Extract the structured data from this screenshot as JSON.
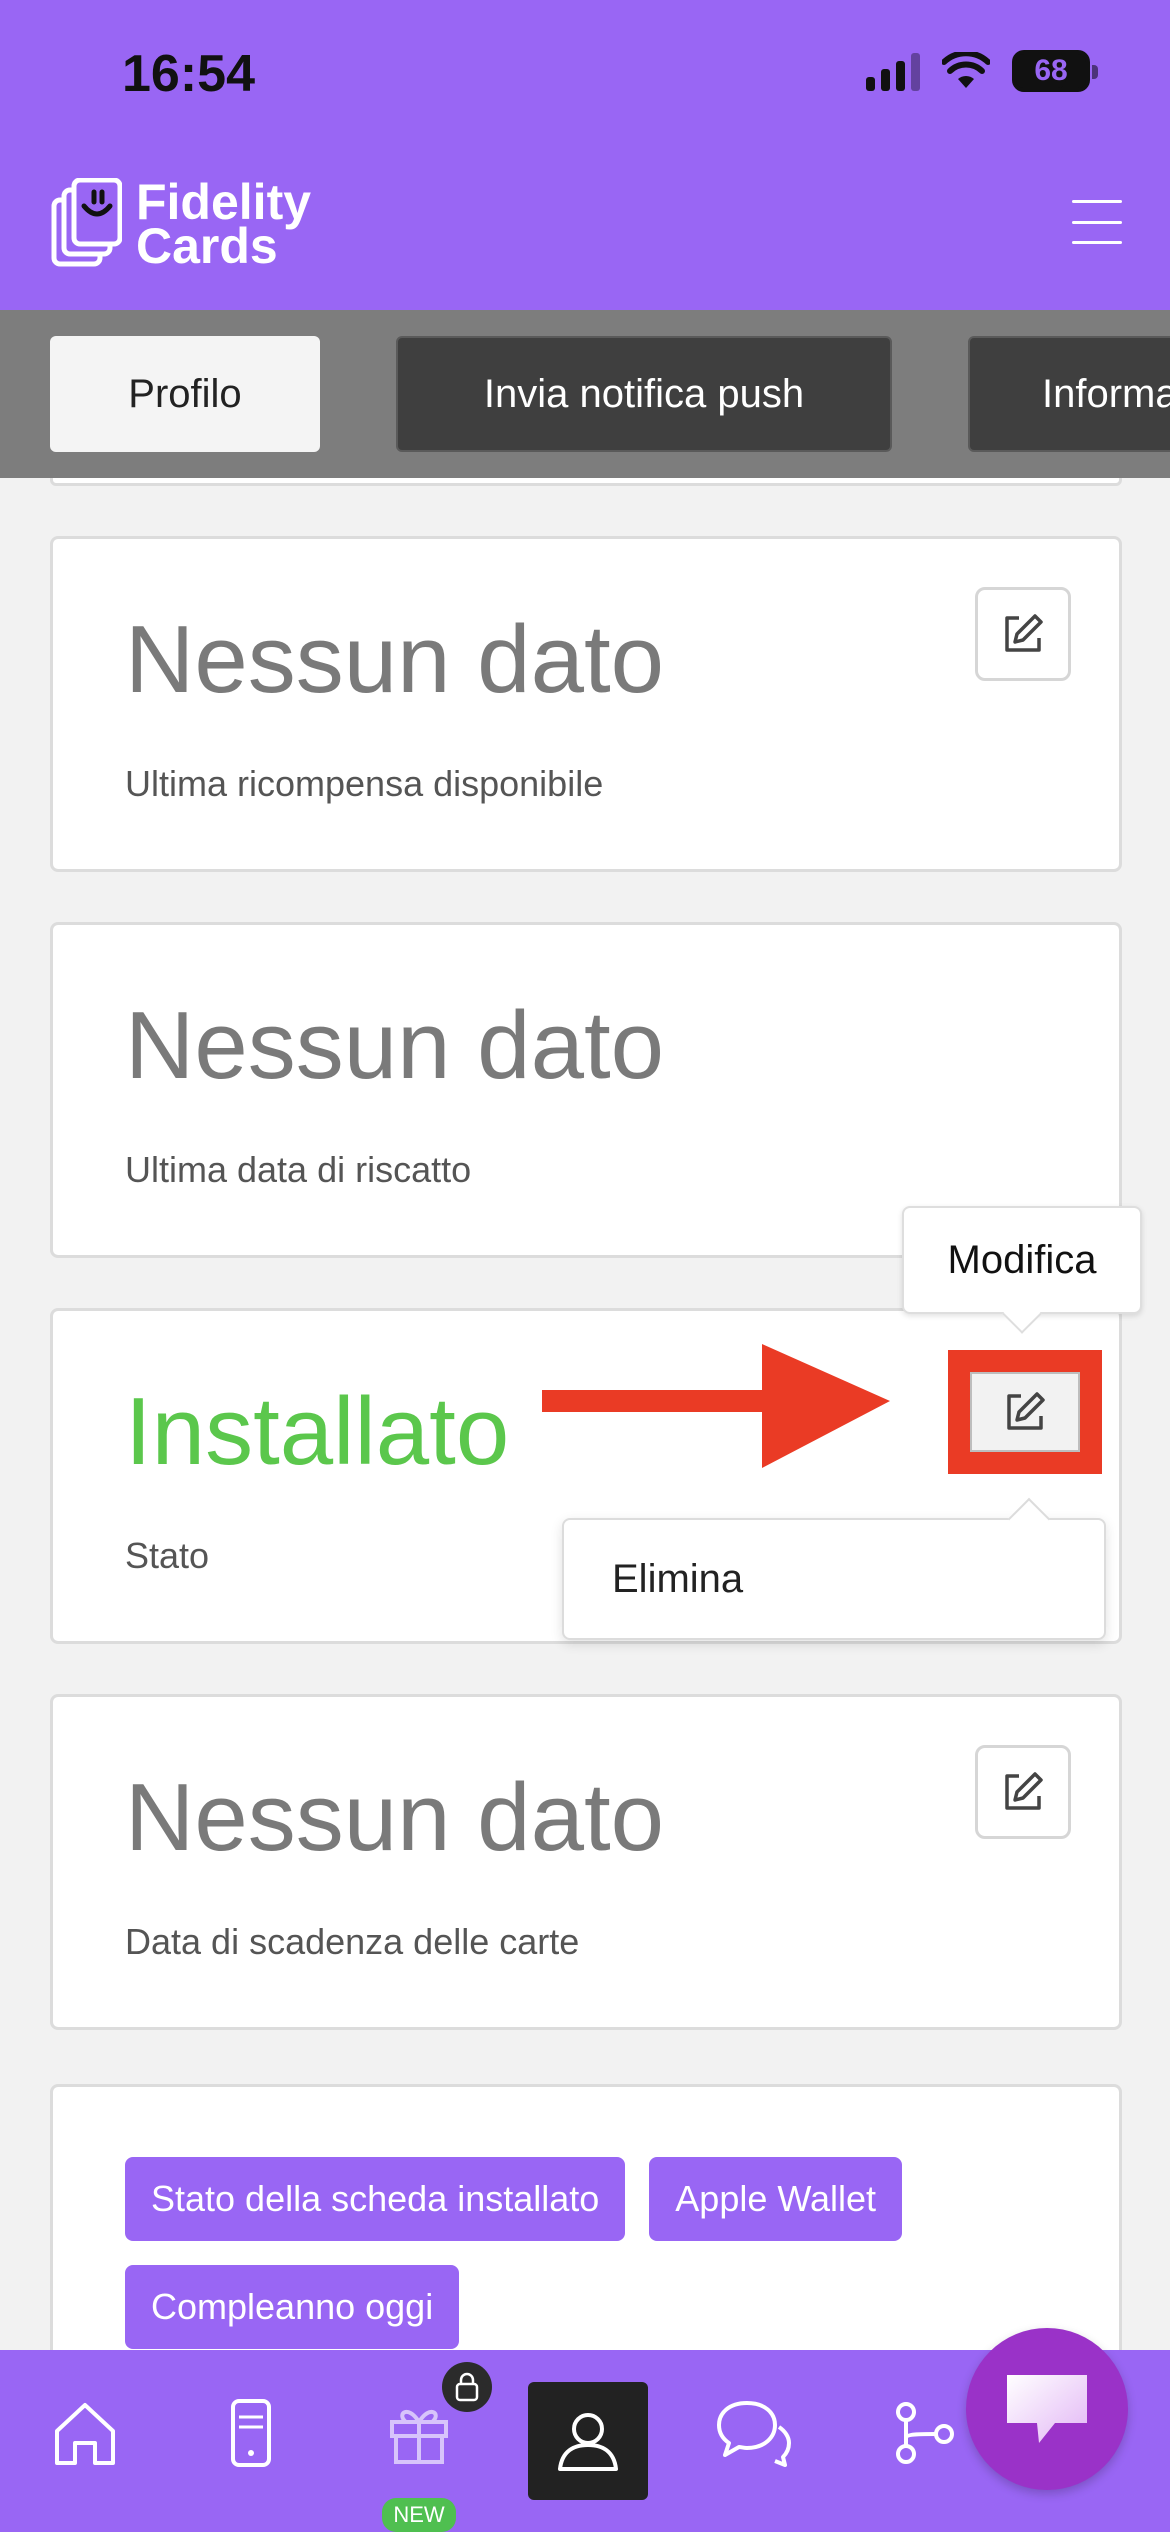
{
  "status_bar": {
    "time": "16:54",
    "battery": "68"
  },
  "brand": {
    "line1": "Fidelity",
    "line2": "Cards"
  },
  "tabs": [
    {
      "label": "Profilo"
    },
    {
      "label": "Invia notifica push"
    },
    {
      "label": "Informa"
    }
  ],
  "cards": [
    {
      "value": "Nessun dato",
      "label": "Ultima ricompensa disponibile"
    },
    {
      "value": "Nessun dato",
      "label": "Ultima data di riscatto"
    },
    {
      "value": "Installato",
      "label": "Stato"
    },
    {
      "value": "Nessun dato",
      "label": "Data di scadenza delle carte"
    }
  ],
  "tooltip": {
    "text": "Modifica"
  },
  "popover_menu": {
    "delete_label": "Elimina"
  },
  "tags": [
    {
      "label": "Stato della scheda installato"
    },
    {
      "label": "Apple Wallet"
    },
    {
      "label": "Compleanno oggi"
    }
  ],
  "bottom_nav": {
    "new_badge": "NEW"
  },
  "colors": {
    "brand": "#9966f4",
    "status_green": "#5bc74c",
    "annotation_red": "#ea3b25"
  }
}
